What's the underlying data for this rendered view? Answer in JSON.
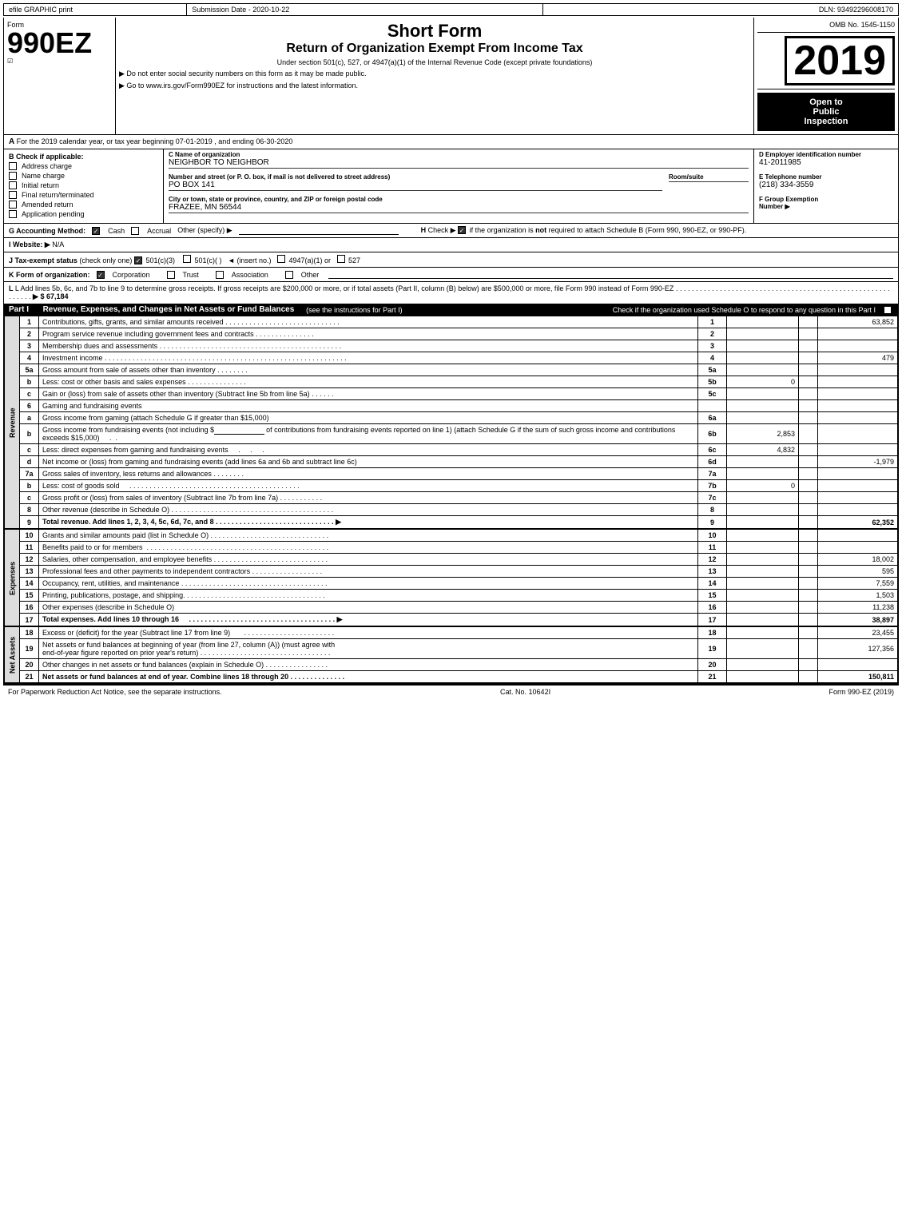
{
  "topbar": {
    "left": "efile GRAPHIC print",
    "mid": "Submission Date - 2020-10-22",
    "right": "DLN: 93492296008170"
  },
  "header": {
    "form_label": "Form",
    "form_number": "990EZ",
    "short_form": "Short Form",
    "return_title": "Return of Organization Exempt From Income Tax",
    "subtitle": "Under section 501(c), 527, or 4947(a)(1) of the Internal Revenue Code (except private foundations)",
    "no_ssn": "▶ Do not enter social security numbers on this form as it may be made public.",
    "irs_link": "▶ Go to www.irs.gov/Form990EZ for instructions and the latest information.",
    "omb": "OMB No. 1545-1150",
    "year": "2019",
    "open_to_public": "Open to\nPublic\nInspection"
  },
  "tax_year_line": "For the 2019 calendar year, or tax year beginning 07-01-2019 , and ending 06-30-2020",
  "check_section": {
    "check_label": "B Check if applicable:",
    "checks": [
      {
        "id": "address-change",
        "label": "Address charge",
        "checked": false
      },
      {
        "id": "name-change",
        "label": "Name charge",
        "checked": false
      },
      {
        "id": "initial-return",
        "label": "Initial return",
        "checked": false
      },
      {
        "id": "final-return",
        "label": "Final return/terminated",
        "checked": false
      },
      {
        "id": "amended-return",
        "label": "Amended return",
        "checked": false
      },
      {
        "id": "application-pending",
        "label": "Application pending",
        "checked": false
      }
    ],
    "c_label": "C Name of organization",
    "org_name": "NEIGHBOR TO NEIGHBOR",
    "address_label": "Number and street (or P. O. box, if mail is not delivered to street address)",
    "address": "PO BOX 141",
    "room_label": "Room/suite",
    "city_label": "City or town, state or province, country, and ZIP or foreign postal code",
    "city": "FRAZEE, MN  56544",
    "d_label": "D Employer identification number",
    "ein": "41-2011985",
    "e_label": "E Telephone number",
    "phone": "(218) 334-3559",
    "f_label": "F Group Exemption\nNumber"
  },
  "accounting": {
    "g_label": "G Accounting Method:",
    "cash_checked": true,
    "accrual_checked": false,
    "other_label": "Other (specify) ▶"
  },
  "h_check": {
    "label": "H  Check ▶",
    "checked": true,
    "text": "if the organization is not required to attach Schedule B (Form 990, 990-EZ, or 990-PF)."
  },
  "website": {
    "label": "I Website: ▶",
    "value": "N/A"
  },
  "tax_exempt": {
    "label": "J Tax-exempt status",
    "note": "(check only one)",
    "options": [
      {
        "label": "501(c)(3)",
        "checked": true
      },
      {
        "label": "501(c)(  )",
        "checked": false
      },
      {
        "label": "(insert no.)",
        "checked": false
      },
      {
        "label": "4947(a)(1) or",
        "checked": false
      },
      {
        "label": "527",
        "checked": false
      }
    ]
  },
  "form_org": {
    "label": "K Form of organization:",
    "options": [
      {
        "label": "Corporation",
        "checked": true
      },
      {
        "label": "Trust",
        "checked": false
      },
      {
        "label": "Association",
        "checked": false
      },
      {
        "label": "Other",
        "checked": false
      }
    ]
  },
  "add_lines": {
    "text": "L Add lines 5b, 6c, and 7b to line 9 to determine gross receipts. If gross receipts are $200,000 or more, or if total assets (Part II, column (B) below) are $500,000 or more, file Form 990 instead of Form 990-EZ",
    "dots": ". . . . . . . . . . . . . . . . . . . . . . . . . . . . . . . . . .",
    "amount": "▶ $ 67,184"
  },
  "part1": {
    "header": "Part I",
    "title": "Revenue, Expenses, and Changes in Net Assets or Fund Balances",
    "instructions": "(see the instructions for Part I)",
    "check_schedule": "Check if the organization used Schedule O to respond to any question in this Part I",
    "rows": [
      {
        "num": "1",
        "desc": "Contributions, gifts, grants, and similar amounts received",
        "dots": true,
        "line_ref": "1",
        "amount": "63,852"
      },
      {
        "num": "2",
        "desc": "Program service revenue including government fees and contracts",
        "dots": true,
        "line_ref": "2",
        "amount": ""
      },
      {
        "num": "3",
        "desc": "Membership dues and assessments",
        "dots": true,
        "line_ref": "3",
        "amount": ""
      },
      {
        "num": "4",
        "desc": "Investment income",
        "dots": true,
        "line_ref": "4",
        "amount": "479"
      },
      {
        "num": "5a",
        "desc": "Gross amount from sale of assets other than inventory",
        "sub_label": "5a",
        "sub_amount": ""
      },
      {
        "num": "5b",
        "desc": "Less: cost or other basis and sales expenses",
        "sub_label": "5b",
        "sub_amount": "0"
      },
      {
        "num": "5c",
        "desc": "Gain or (loss) from sale of assets other than inventory (Subtract line 5b from line 5a)",
        "dots": true,
        "line_ref": "5c",
        "amount": ""
      },
      {
        "num": "6",
        "desc": "Gaming and fundraising events",
        "dots": false,
        "header": true
      },
      {
        "num": "6a",
        "desc": "Gross income from gaming (attach Schedule G if greater than $15,000)",
        "sub_label": "6a",
        "sub_amount": ""
      },
      {
        "num": "6b_text",
        "desc": "Gross income from fundraising events (not including $",
        "of_contributions": "of contributions from\nfundraising events reported on line 1) (attach Schedule G if the\nsum of such gross income and contributions exceeds $15,000)",
        "sub_label": "6b",
        "sub_amount": "2,853"
      },
      {
        "num": "6c",
        "desc": "Less: direct expenses from gaming and fundraising events",
        "sub_label": "6c",
        "sub_amount": "4,832"
      },
      {
        "num": "6d",
        "desc": "Net income or (loss) from gaming and fundraising events (add lines 6a and 6b and subtract line 6c)",
        "line_ref": "6d",
        "amount": "-1,979"
      },
      {
        "num": "7a",
        "desc": "Gross sales of inventory, less returns and allowances",
        "sub_label": "7a",
        "sub_amount": ""
      },
      {
        "num": "7b",
        "desc": "Less: cost of goods sold",
        "sub_label": "7b",
        "sub_amount": "0"
      },
      {
        "num": "7c",
        "desc": "Gross profit or (loss) from sales of inventory (Subtract line 7b from line 7a)",
        "dots": true,
        "line_ref": "7c",
        "amount": ""
      },
      {
        "num": "8",
        "desc": "Other revenue (describe in Schedule O)",
        "dots": true,
        "line_ref": "8",
        "amount": ""
      },
      {
        "num": "9",
        "desc": "Total revenue. Add lines 1, 2, 3, 4, 5c, 6d, 7c, and 8",
        "dots": true,
        "line_ref": "9",
        "amount": "62,352",
        "bold": true
      }
    ]
  },
  "expenses_rows": [
    {
      "num": "10",
      "desc": "Grants and similar amounts paid (list in Schedule O)",
      "dots": true,
      "line_ref": "10",
      "amount": ""
    },
    {
      "num": "11",
      "desc": "Benefits paid to or for members",
      "dots": true,
      "line_ref": "11",
      "amount": ""
    },
    {
      "num": "12",
      "desc": "Salaries, other compensation, and employee benefits",
      "dots": true,
      "line_ref": "12",
      "amount": "18,002"
    },
    {
      "num": "13",
      "desc": "Professional fees and other payments to independent contractors",
      "dots": true,
      "line_ref": "13",
      "amount": "595"
    },
    {
      "num": "14",
      "desc": "Occupancy, rent, utilities, and maintenance",
      "dots": true,
      "line_ref": "14",
      "amount": "7,559"
    },
    {
      "num": "15",
      "desc": "Printing, publications, postage, and shipping.",
      "dots": true,
      "line_ref": "15",
      "amount": "1,503"
    },
    {
      "num": "16",
      "desc": "Other expenses (describe in Schedule O)",
      "dots": false,
      "line_ref": "16",
      "amount": "11,238"
    },
    {
      "num": "17",
      "desc": "Total expenses. Add lines 10 through 16",
      "dots": true,
      "line_ref": "17",
      "amount": "38,897",
      "bold": true
    }
  ],
  "net_assets_rows": [
    {
      "num": "18",
      "desc": "Excess or (deficit) for the year (Subtract line 17 from line 9)",
      "dots": true,
      "line_ref": "18",
      "amount": "23,455"
    },
    {
      "num": "19",
      "desc": "Net assets or fund balances at beginning of year (from line 27, column (A)) (must agree with\nend-of-year figure reported on prior year's return)",
      "dots": true,
      "line_ref": "19",
      "amount": "127,356"
    },
    {
      "num": "20",
      "desc": "Other changes in net assets or fund balances (explain in Schedule O)",
      "dots": true,
      "line_ref": "20",
      "amount": ""
    },
    {
      "num": "21",
      "desc": "Net assets or fund balances at end of year. Combine lines 18 through 20",
      "dots": true,
      "line_ref": "21",
      "amount": "150,811"
    }
  ],
  "footer": {
    "left": "For Paperwork Reduction Act Notice, see the separate instructions.",
    "mid": "Cat. No. 10642I",
    "right": "Form 990-EZ (2019)"
  }
}
